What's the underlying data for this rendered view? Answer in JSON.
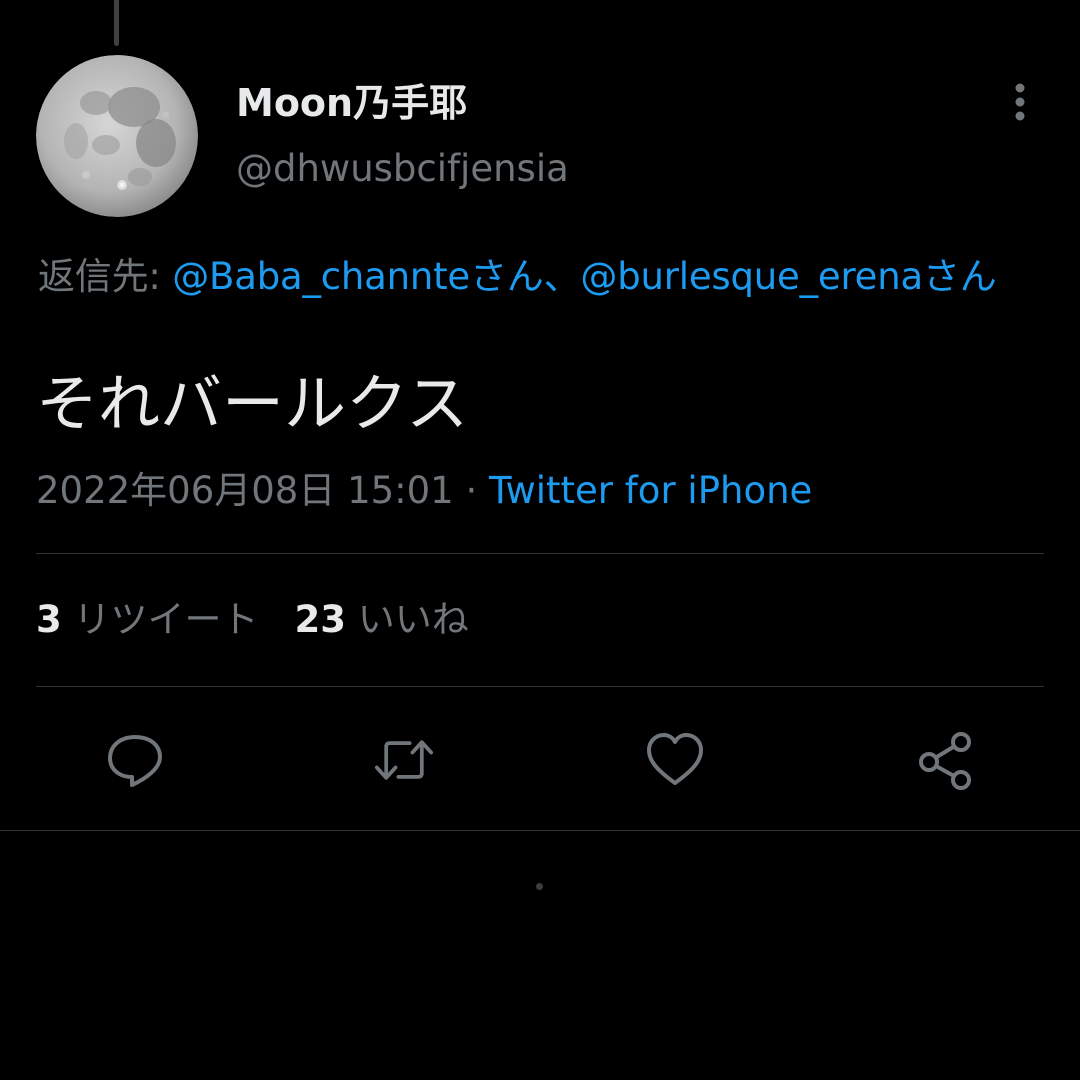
{
  "tweet": {
    "author": {
      "display_name": "Moon乃手耶",
      "handle": "@dhwusbcifjensia",
      "avatar_icon": "full-moon-avatar"
    },
    "more_icon": "more-vertical-icon",
    "reply_to": {
      "prefix": "返信先: ",
      "mention_1": "@Baba_channteさん",
      "separator": "、",
      "mention_2": "@burlesque_erenaさん"
    },
    "text": "それバールクス",
    "timestamp": "2022年06月08日 15:01",
    "meta_separator": " · ",
    "source": "Twitter for iPhone",
    "stats": {
      "retweets_count": "3",
      "retweets_label": "リツイート",
      "likes_count": "23",
      "likes_label": "いいね"
    },
    "actions": [
      {
        "name": "reply",
        "icon": "reply-icon"
      },
      {
        "name": "retweet",
        "icon": "retweet-icon"
      },
      {
        "name": "like",
        "icon": "heart-icon"
      },
      {
        "name": "share",
        "icon": "share-icon"
      }
    ]
  },
  "colors": {
    "background": "#000000",
    "primary_text": "#e7e9ea",
    "secondary_text": "#71767b",
    "accent": "#1d9bf0",
    "divider": "#2f3336"
  }
}
